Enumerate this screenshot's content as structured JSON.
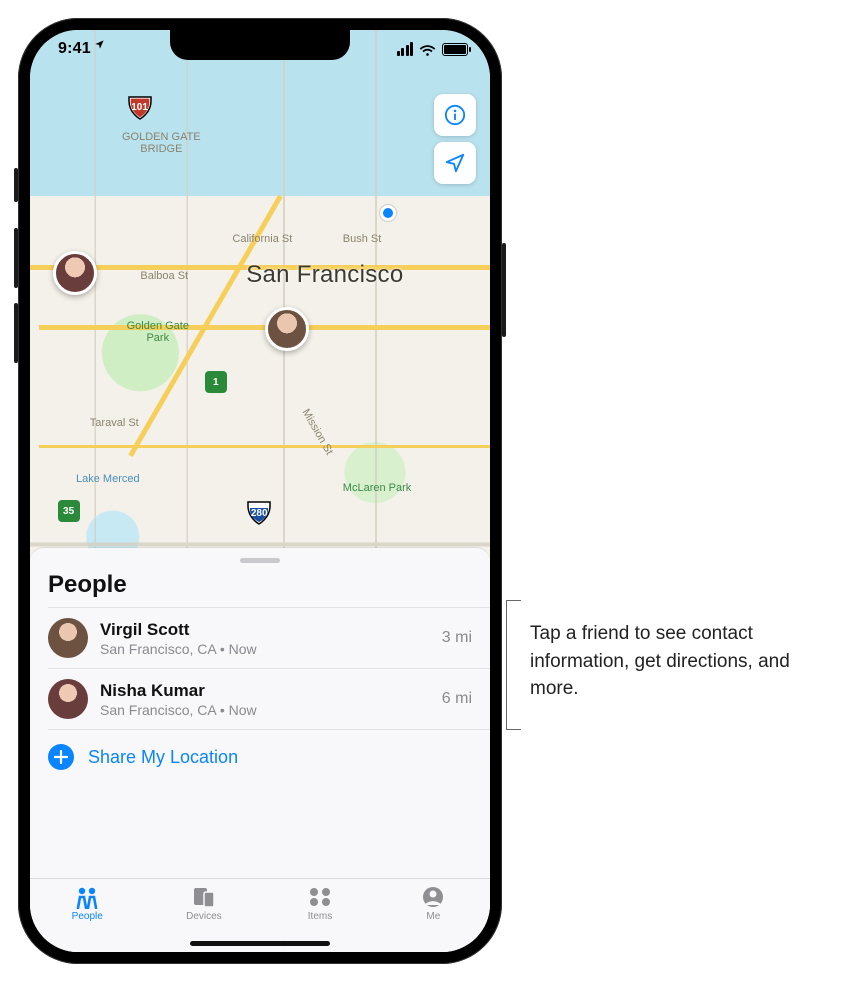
{
  "status": {
    "time": "9:41"
  },
  "map": {
    "city": "San Francisco",
    "labels": {
      "gg_bridge": "GOLDEN GATE\nBRIDGE",
      "gg_park": "Golden Gate\nPark",
      "california": "California St",
      "bush": "Bush St",
      "balboa": "Balboa St",
      "taraval": "Taraval St",
      "mission": "Mission St",
      "lake_merced": "Lake Merced",
      "mclaren": "McLaren Park"
    },
    "highways": {
      "r101": "101",
      "r280": "280",
      "r1": "1",
      "r35": "35"
    }
  },
  "sheet": {
    "title": "People",
    "people": [
      {
        "name": "Virgil Scott",
        "sub": "San Francisco, CA • Now",
        "distance": "3 mi"
      },
      {
        "name": "Nisha Kumar",
        "sub": "San Francisco, CA • Now",
        "distance": "6 mi"
      }
    ],
    "share_label": "Share My Location"
  },
  "tabs": {
    "people": "People",
    "devices": "Devices",
    "items": "Items",
    "me": "Me"
  },
  "callout": "Tap a friend to see contact information, get directions, and more."
}
